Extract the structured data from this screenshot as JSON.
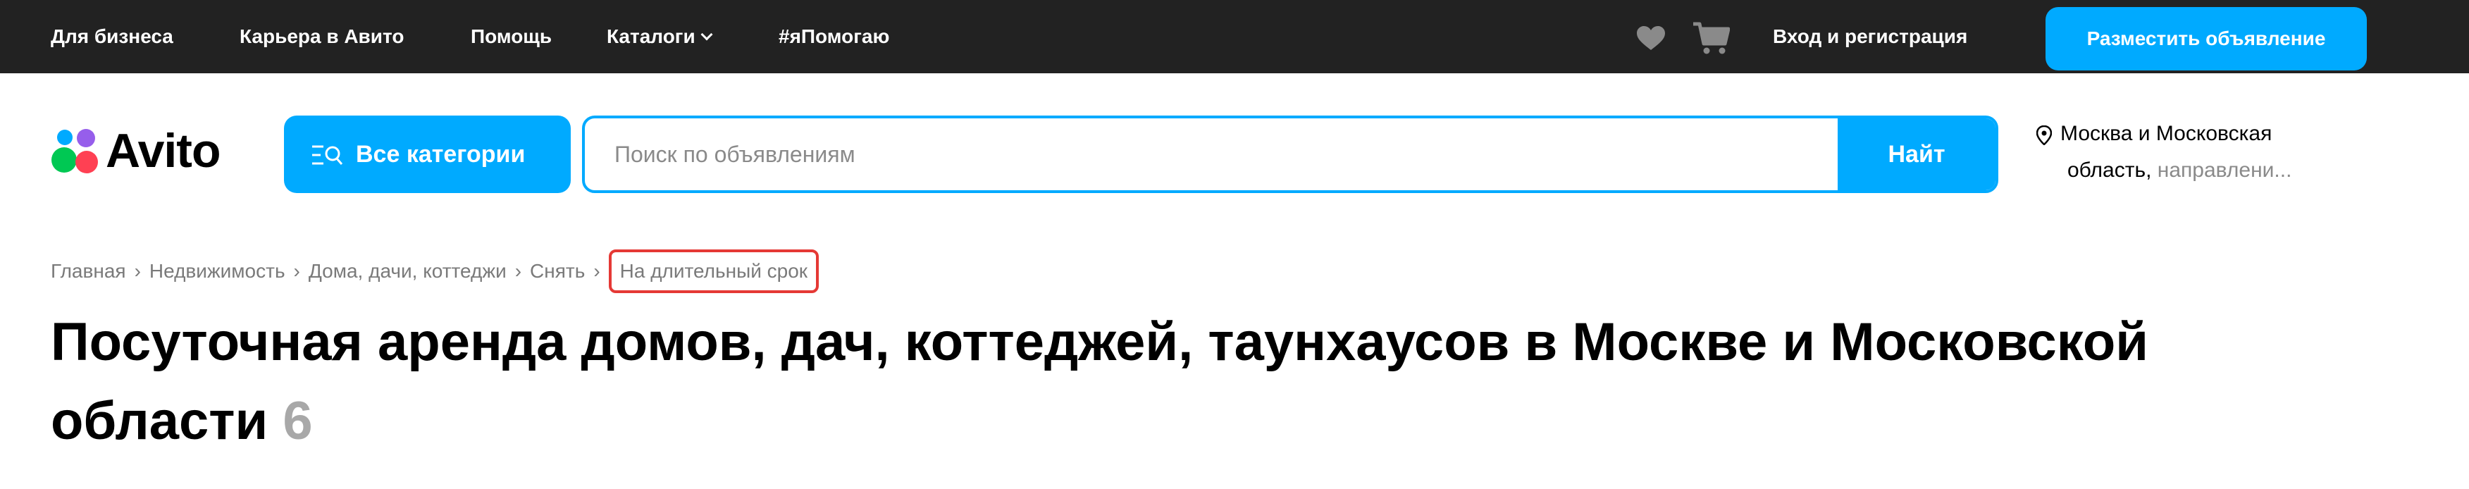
{
  "topbar": {
    "links": [
      "Для бизнеса",
      "Карьера в Авито",
      "Помощь",
      "Каталоги",
      "#яПомогаю"
    ],
    "login": "Вход и регистрация",
    "post_ad": "Разместить объявление"
  },
  "header": {
    "logo_text": "Avito",
    "categories_button": "Все категории",
    "search_placeholder": "Поиск по объявлениям",
    "search_button": "Найт",
    "location_line1": "Москва и Московская",
    "location_line2_main": "область,",
    "location_line2_dir": "направлени..."
  },
  "breadcrumb": {
    "items": [
      "Главная",
      "Недвижимость",
      "Дома, дачи, коттеджи",
      "Снять"
    ],
    "current": "На длительный срок"
  },
  "main": {
    "title": "Посуточная аренда домов, дач, коттеджей, таунхаусов в Москве и Московской области",
    "count": "6"
  },
  "colors": {
    "topbar_bg": "#222222",
    "accent": "#00aaff",
    "highlight": "#e53935"
  }
}
